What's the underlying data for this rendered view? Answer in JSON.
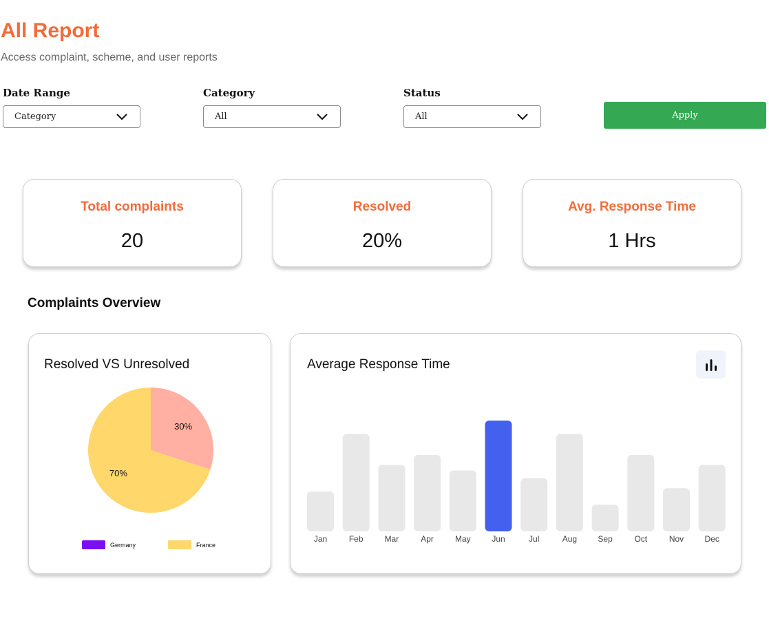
{
  "header": {
    "title": "All Report",
    "subtitle": "Access complaint, scheme, and user reports"
  },
  "filters": {
    "date_range": {
      "label": "Date Range",
      "value": "Category"
    },
    "category": {
      "label": "Category",
      "value": "All"
    },
    "status": {
      "label": "Status",
      "value": "All"
    },
    "apply_label": "Apply"
  },
  "stats": [
    {
      "label": "Total complaints",
      "value": "20"
    },
    {
      "label": "Resolved",
      "value": "20%"
    },
    {
      "label": "Avg. Response Time",
      "value": "1 Hrs"
    }
  ],
  "overview": {
    "title": "Complaints Overview"
  },
  "colors": {
    "accent": "#f26b3a",
    "apply": "#34a853",
    "bar_default": "#e8e8e8",
    "bar_highlight": "#4361ee"
  },
  "chart_data": [
    {
      "type": "pie",
      "title": "Resolved VS Unresolved",
      "slices": [
        {
          "label": "30%",
          "value": 30,
          "color": "#ffb0a3"
        },
        {
          "label": "70%",
          "value": 70,
          "color": "#ffd76a"
        }
      ],
      "legend": [
        {
          "name": "Germany",
          "color": "#7a0ff0"
        },
        {
          "name": "France",
          "color": "#ffd76a"
        }
      ],
      "legend_position": "bottom"
    },
    {
      "type": "bar",
      "title": "Average Response Time",
      "categories": [
        "Jan",
        "Feb",
        "Mar",
        "Apr",
        "May",
        "Jun",
        "Jul",
        "Aug",
        "Sep",
        "Oct",
        "Nov",
        "Dec"
      ],
      "values": [
        36,
        88,
        60,
        69,
        55,
        100,
        48,
        88,
        24,
        69,
        39,
        60
      ],
      "highlight_index": 5,
      "ylim": [
        0,
        100
      ],
      "grid": false,
      "icon": "bar-chart-icon"
    }
  ]
}
